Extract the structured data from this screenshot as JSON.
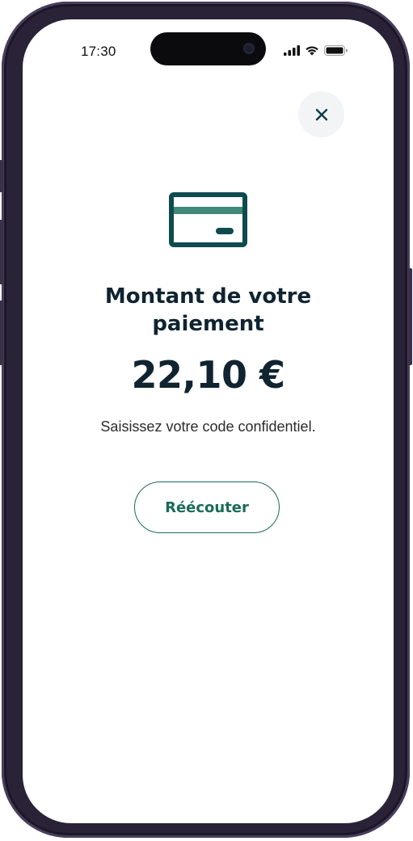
{
  "status_bar": {
    "time": "17:30",
    "icons": [
      "signal-icon",
      "wifi-icon",
      "battery-icon"
    ]
  },
  "header": {
    "close_icon": "close-icon"
  },
  "payment": {
    "icon": "credit-card-icon",
    "title_line1": "Montant de votre",
    "title_line2": "paiement",
    "amount": "22,10 €",
    "instruction": "Saisissez votre code confidentiel."
  },
  "actions": {
    "replay_label": "Réécouter"
  },
  "colors": {
    "primary_dark": "#0f2430",
    "accent_green": "#1a6b5a",
    "card_stripe": "#3f8a78",
    "close_bg": "#f2f4f5"
  }
}
